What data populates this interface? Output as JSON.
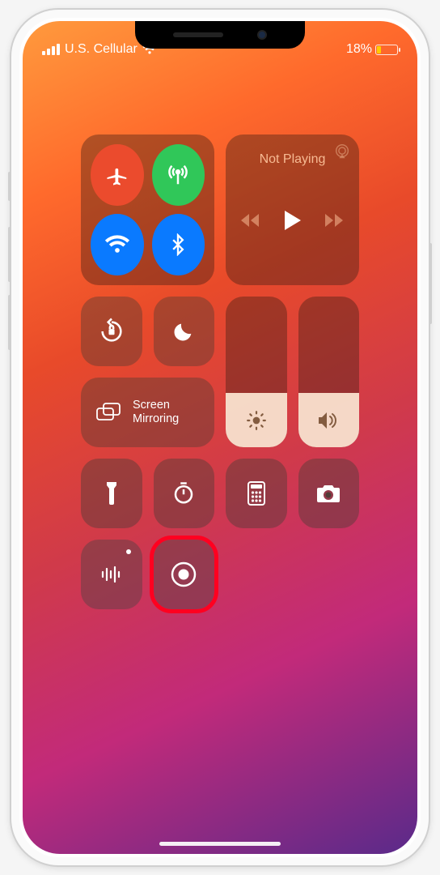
{
  "status": {
    "carrier": "U.S. Cellular",
    "battery_pct": "18%"
  },
  "media": {
    "title": "Not Playing"
  },
  "screen_mirroring": {
    "label": "Screen\nMirroring"
  },
  "connectivity": {
    "airplane_on": true,
    "cellular_on": true,
    "wifi_on": true,
    "bluetooth_on": true
  },
  "sliders": {
    "brightness_pct": 36,
    "volume_pct": 36
  },
  "highlight": {
    "target": "screen-record-button"
  }
}
